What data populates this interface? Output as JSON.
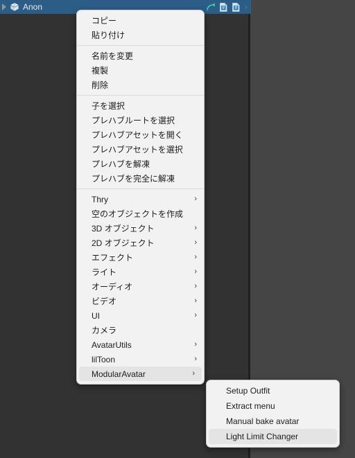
{
  "window": {
    "background_dark": "#323232",
    "background_light": "#454545",
    "divider_color": "#212121"
  },
  "hierarchy": {
    "selected_object": "Anon",
    "selection_color": "#2c5d87",
    "foldout_icon": "triangle-right-icon",
    "object_icon": "prefab-cube-icon",
    "toolbar_icons": [
      {
        "name": "prefab-override-arrow-icon"
      },
      {
        "name": "prefab-asset-icon-1"
      },
      {
        "name": "prefab-asset-icon-2"
      }
    ],
    "overflow_chevron": "›"
  },
  "context_menu": {
    "background": "#f2f2f2",
    "highlight_color": "#e4e4e4",
    "submenu_arrow": "›",
    "groups": [
      {
        "items": [
          {
            "label": "コピー",
            "has_submenu": false,
            "highlighted": false
          },
          {
            "label": "貼り付け",
            "has_submenu": false,
            "highlighted": false
          }
        ]
      },
      {
        "items": [
          {
            "label": "名前を変更",
            "has_submenu": false,
            "highlighted": false
          },
          {
            "label": "複製",
            "has_submenu": false,
            "highlighted": false
          },
          {
            "label": "削除",
            "has_submenu": false,
            "highlighted": false
          }
        ]
      },
      {
        "items": [
          {
            "label": "子を選択",
            "has_submenu": false,
            "highlighted": false
          },
          {
            "label": "プレハブルートを選択",
            "has_submenu": false,
            "highlighted": false
          },
          {
            "label": "プレハブアセットを開く",
            "has_submenu": false,
            "highlighted": false
          },
          {
            "label": "プレハブアセットを選択",
            "has_submenu": false,
            "highlighted": false
          },
          {
            "label": "プレハブを解凍",
            "has_submenu": false,
            "highlighted": false
          },
          {
            "label": "プレハブを完全に解凍",
            "has_submenu": false,
            "highlighted": false
          }
        ]
      },
      {
        "items": [
          {
            "label": "Thry",
            "has_submenu": true,
            "highlighted": false
          },
          {
            "label": "空のオブジェクトを作成",
            "has_submenu": false,
            "highlighted": false
          },
          {
            "label": "3D オブジェクト",
            "has_submenu": true,
            "highlighted": false
          },
          {
            "label": "2D オブジェクト",
            "has_submenu": true,
            "highlighted": false
          },
          {
            "label": "エフェクト",
            "has_submenu": true,
            "highlighted": false
          },
          {
            "label": "ライト",
            "has_submenu": true,
            "highlighted": false
          },
          {
            "label": "オーディオ",
            "has_submenu": true,
            "highlighted": false
          },
          {
            "label": "ビデオ",
            "has_submenu": true,
            "highlighted": false
          },
          {
            "label": "UI",
            "has_submenu": true,
            "highlighted": false
          },
          {
            "label": "カメラ",
            "has_submenu": false,
            "highlighted": false
          },
          {
            "label": "AvatarUtils",
            "has_submenu": true,
            "highlighted": false
          },
          {
            "label": "lilToon",
            "has_submenu": true,
            "highlighted": false
          },
          {
            "label": "ModularAvatar",
            "has_submenu": true,
            "highlighted": true
          }
        ]
      }
    ]
  },
  "submenu": {
    "parent": "ModularAvatar",
    "items": [
      {
        "label": "Setup Outfit",
        "highlighted": false
      },
      {
        "label": "Extract menu",
        "highlighted": false
      },
      {
        "label": "Manual bake avatar",
        "highlighted": false
      },
      {
        "label": "Light Limit Changer",
        "highlighted": true
      }
    ]
  }
}
